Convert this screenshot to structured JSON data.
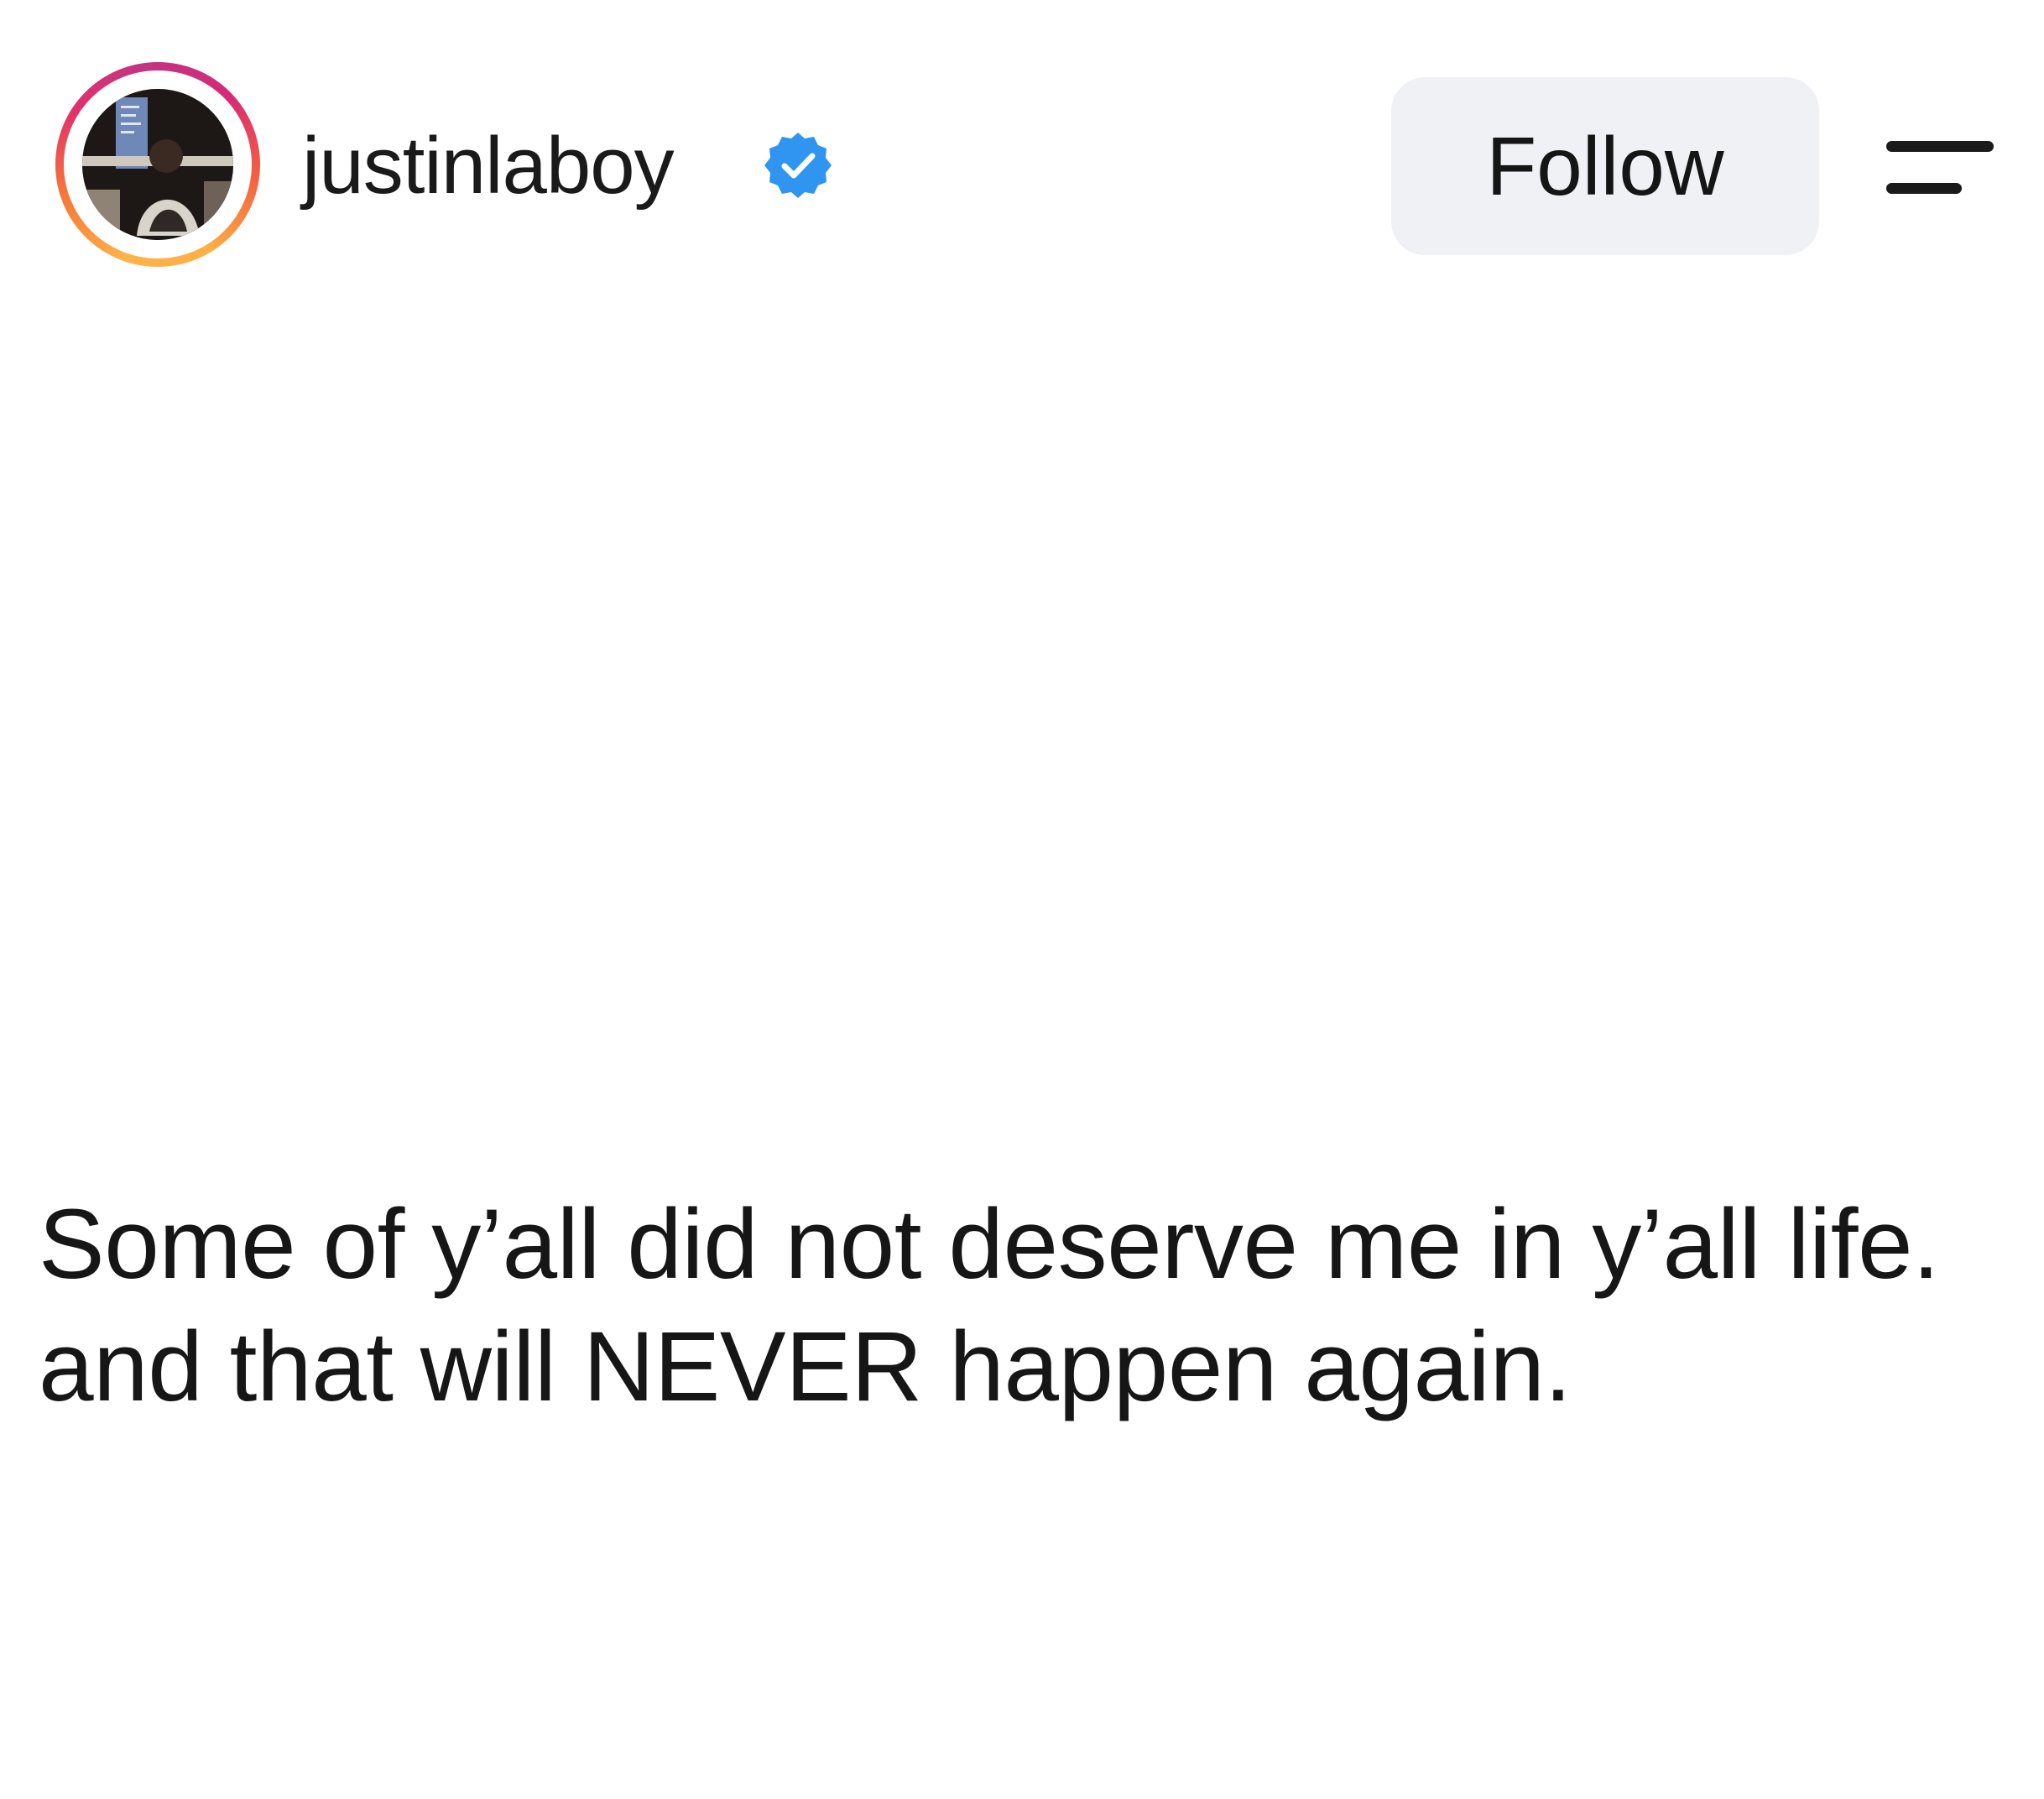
{
  "profile": {
    "username": "justinlaboy",
    "verified": true,
    "avatar_icon": "profile-photo",
    "ring_colors": [
      "#fdb34a",
      "#f77737",
      "#e1306c",
      "#c13584"
    ],
    "verified_color": "#2f95f0"
  },
  "actions": {
    "follow_label": "Follow",
    "menu_icon": "menu-icon"
  },
  "post": {
    "lines": [
      "Some of y’all did not deserve me in y’all life.",
      "and that will NEVER happen again."
    ]
  }
}
